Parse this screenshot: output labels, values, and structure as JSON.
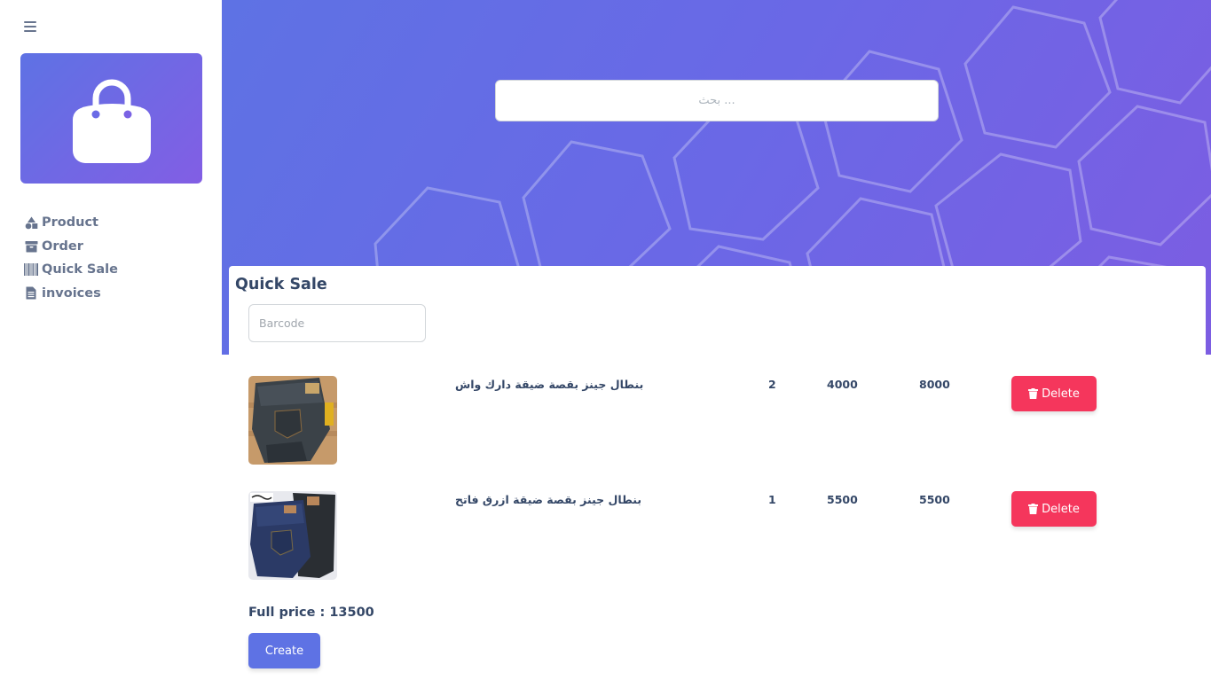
{
  "sidebar": {
    "toggle_icon": "hamburger-icon",
    "logo_icon": "shopping-bag-icon",
    "items": [
      {
        "label": "Product",
        "icon": "shapes-icon"
      },
      {
        "label": "Order",
        "icon": "archive-box-icon"
      },
      {
        "label": "Quick Sale",
        "icon": "barcode-icon"
      },
      {
        "label": "invoices",
        "icon": "document-icon"
      }
    ]
  },
  "header": {
    "search_placeholder": "بحث ..."
  },
  "main": {
    "title": "Quick Sale",
    "barcode_placeholder": "Barcode",
    "rows": [
      {
        "name": "بنطال جينز بقصة ضيقة دارك واش",
        "qty": "2",
        "price": "4000",
        "total": "8000",
        "delete_label": "Delete"
      },
      {
        "name": "بنطال جينز بقصة ضيقة ازرق فاتح",
        "qty": "1",
        "price": "5500",
        "total": "5500",
        "delete_label": "Delete"
      }
    ],
    "full_price": "Full price : 13500",
    "create_label": "Create"
  },
  "colors": {
    "primary": "#5e72e4",
    "gradient_end": "#825ee4",
    "danger": "#f5365c",
    "text": "#344767",
    "muted": "#67748e"
  }
}
